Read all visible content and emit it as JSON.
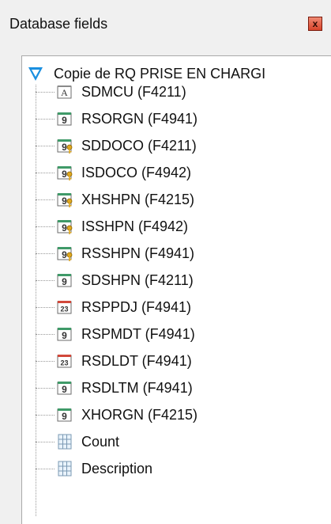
{
  "window": {
    "title": "Database fields",
    "close_glyph": "x"
  },
  "tree": {
    "root": {
      "label": "Copie de RQ PRISE EN CHARGI",
      "icon": "query-funnel-icon"
    },
    "items": [
      {
        "label": "SDMCU (F4211)",
        "icon": "text-field-icon"
      },
      {
        "label": "RSORGN (F4941)",
        "icon": "numeric-field-icon"
      },
      {
        "label": "SDDOCO (F4211)",
        "icon": "numeric-key-field-icon"
      },
      {
        "label": "ISDOCO (F4942)",
        "icon": "numeric-key-field-icon"
      },
      {
        "label": "XHSHPN (F4215)",
        "icon": "numeric-key-field-icon"
      },
      {
        "label": "ISSHPN (F4942)",
        "icon": "numeric-key-field-icon"
      },
      {
        "label": "RSSHPN (F4941)",
        "icon": "numeric-key-field-icon"
      },
      {
        "label": "SDSHPN (F4211)",
        "icon": "numeric-field-icon"
      },
      {
        "label": "RSPPDJ (F4941)",
        "icon": "date-field-icon"
      },
      {
        "label": "RSPMDT (F4941)",
        "icon": "numeric-field-icon"
      },
      {
        "label": "RSDLDT (F4941)",
        "icon": "date-field-icon"
      },
      {
        "label": "RSDLTM (F4941)",
        "icon": "numeric-field-icon"
      },
      {
        "label": "XHORGN (F4215)",
        "icon": "numeric-field-icon"
      },
      {
        "label": "Count",
        "icon": "formula-field-icon"
      },
      {
        "label": "Description",
        "icon": "formula-field-icon"
      }
    ],
    "icon_glyphs": {
      "text": "A",
      "numeric": "9",
      "date": "23"
    }
  },
  "colors": {
    "numeric_accent": "#3f9a68",
    "date_accent": "#d2483a",
    "root_icon": "#1a8fe0",
    "key_icon": "#e0a820"
  }
}
